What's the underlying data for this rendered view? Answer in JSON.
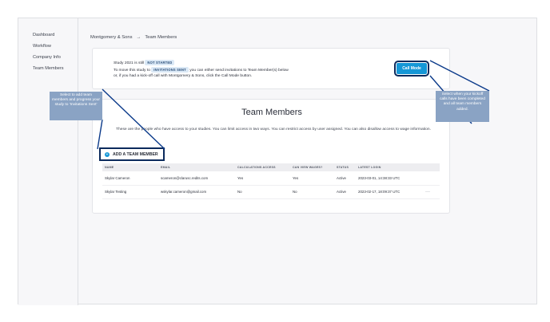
{
  "sidebar": {
    "items": [
      {
        "label": "Dashboard"
      },
      {
        "label": "Workflow"
      },
      {
        "label": "Company Info"
      },
      {
        "label": "Team Members"
      }
    ]
  },
  "breadcrumb": {
    "root": "Montgomery & Sons",
    "separator": "→",
    "current": "Team Members"
  },
  "status": {
    "line1_prefix": "Study 2021 is still",
    "badge_current": "NOT STARTED",
    "line2_prefix": "To move this study to",
    "badge_target": "INVITATIONS SENT",
    "line2_suffix": "you can either send invitations to Team Member(s) below",
    "line3": "or, if you had a kick-off call with Montgomery & Sons, click the Call Mode button.",
    "call_mode_label": "Call Mode"
  },
  "team": {
    "title": "Team Members",
    "description": "These are the people who have access to your studies. You can limit access in two ways. You can restrict access by user assigned. You can also disallow access to wage information.",
    "add_member_label": "ADD A TEAM MEMBER",
    "columns": [
      "NAME",
      "EMAIL",
      "CALCULATIONS ACCESS",
      "CAN VIEW WAGES?",
      "STATUS",
      "LATEST LOGIN",
      ""
    ],
    "rows": [
      {
        "name": "Skylar Cameron",
        "email": "scameron@clarusc.redits.com",
        "calc": "Yes",
        "wages": "Yes",
        "status": "Active",
        "login": "2023-03-01, 14:38:33 UTC",
        "menu": ""
      },
      {
        "name": "Skylar Testing",
        "email": "wskylar.cameron@gmail.com",
        "calc": "No",
        "wages": "No",
        "status": "Active",
        "login": "2023-02-17, 18:09:37 UTC",
        "menu": "···"
      }
    ]
  },
  "callouts": {
    "left": "Select to add team members and progress your study to 'Invitations Sent'",
    "right": "Select when your kickoff calls have been completed and all team members added."
  },
  "colors": {
    "accent": "#1597d6",
    "outline": "#0b2a5c",
    "callout_bg": "#8aa3c4"
  },
  "icons": {
    "add": "plus-circle-icon",
    "row_menu": "ellipsis-icon"
  }
}
